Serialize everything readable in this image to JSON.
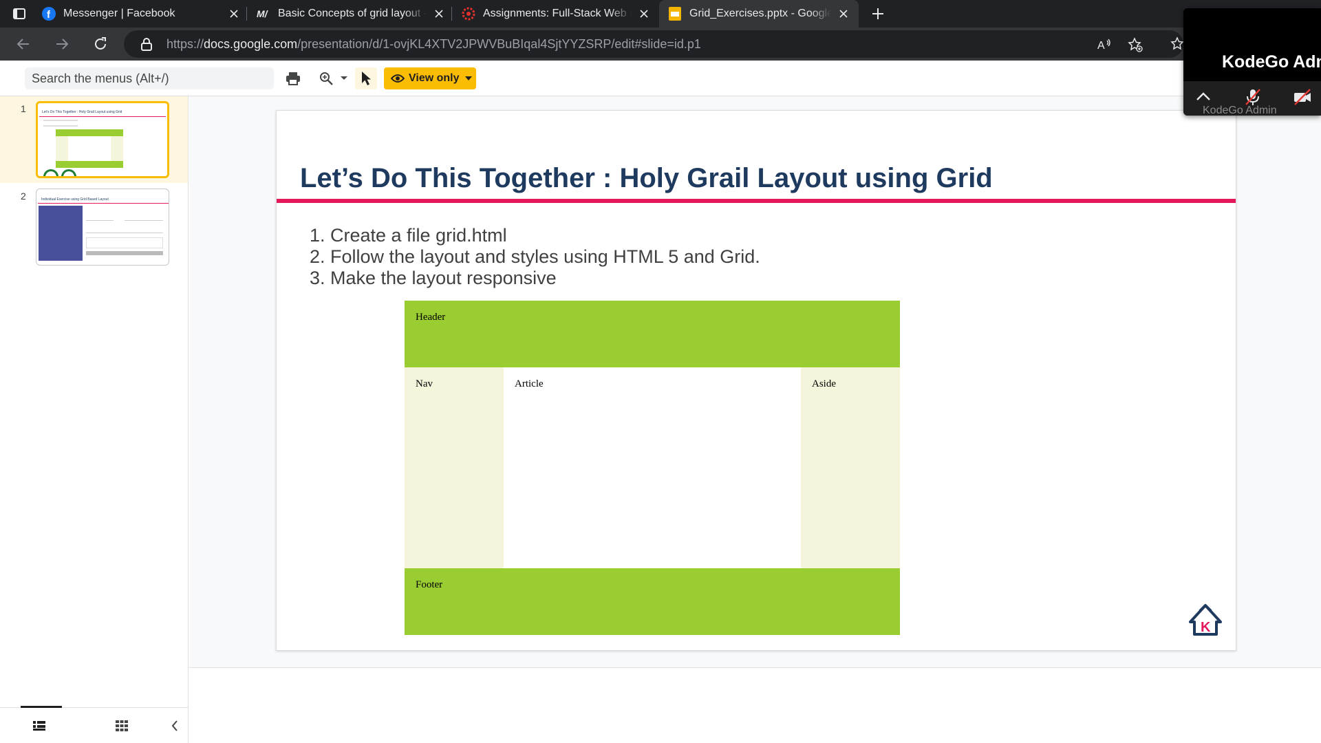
{
  "browser": {
    "tabs": [
      {
        "title": "Messenger | Facebook",
        "active": false,
        "icon": "facebook-icon"
      },
      {
        "title": "Basic Concepts of grid layout - CSS: Cascading Style Sheets | MDN",
        "active": false,
        "icon": "mdn-icon"
      },
      {
        "title": "Assignments: Full-Stack Web Development",
        "active": false,
        "icon": "canvas-lms-icon"
      },
      {
        "title": "Grid_Exercises.pptx - Google Slides",
        "active": true,
        "icon": "google-slides-icon"
      }
    ],
    "url_prefix": "https://",
    "url_domain": "docs.google.com",
    "url_path": "/presentation/d/1-ovjKL4XTV2JPWVBuBIqal4SjtYYZSRP/edit#slide=id.p1"
  },
  "toolbar": {
    "search_placeholder": "Search the menus (Alt+/)",
    "view_only_label": "View only"
  },
  "filmstrip": {
    "slides": [
      {
        "number": "1",
        "title": "Let’s Do This Together :  Holy Grail Layout using Grid"
      },
      {
        "number": "2",
        "title": "Individual Exercise using Grid Based Layout"
      }
    ]
  },
  "slide": {
    "title": "Let’s Do This Together :  Holy Grail Layout using Grid",
    "steps": [
      {
        "n": "1.",
        "text": "Create a file grid.html"
      },
      {
        "n": "2.",
        "text": "Follow the layout and styles using HTML 5 and Grid."
      },
      {
        "n": "3.",
        "text": "Make the layout responsive"
      }
    ],
    "grid": {
      "header": "Header",
      "nav": "Nav",
      "article": "Article",
      "aside": "Aside",
      "footer": "Footer"
    }
  },
  "meeting": {
    "name": "KodeGo Adm",
    "participant_label": "KodeGo Admin"
  },
  "colors": {
    "accent_yellow": "#fbbc04",
    "title_blue": "#1f3a5f",
    "rule_pink": "#e5185a",
    "grid_green": "#9acd32",
    "grid_beige": "#f5f5dc"
  }
}
